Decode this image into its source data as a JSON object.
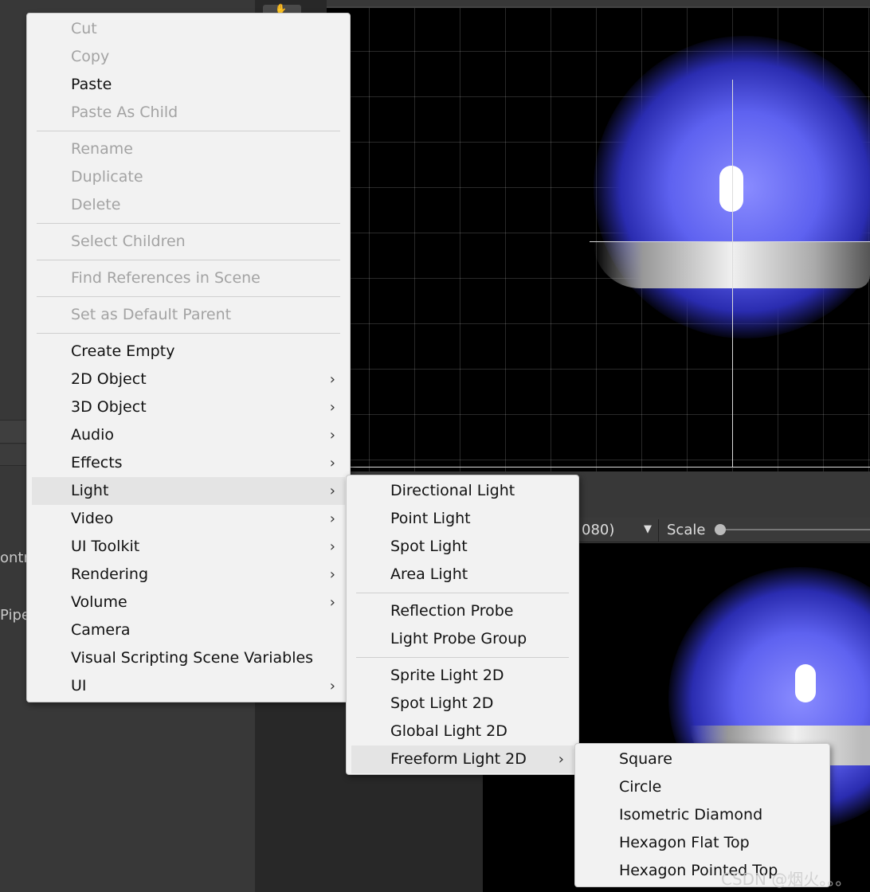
{
  "left_panel": {
    "text_1": "ontr",
    "text_2": "Pipe"
  },
  "game_view": {
    "resolution_partial": "080)",
    "scale_label": "Scale"
  },
  "main_menu": {
    "items": [
      {
        "label": "Cut",
        "enabled": false
      },
      {
        "label": "Copy",
        "enabled": false
      },
      {
        "label": "Paste",
        "enabled": true
      },
      {
        "label": "Paste As Child",
        "enabled": false
      },
      {
        "label": "Rename",
        "enabled": false
      },
      {
        "label": "Duplicate",
        "enabled": false
      },
      {
        "label": "Delete",
        "enabled": false
      },
      {
        "label": "Select Children",
        "enabled": false
      },
      {
        "label": "Find References in Scene",
        "enabled": false
      },
      {
        "label": "Set as Default Parent",
        "enabled": false
      },
      {
        "label": "Create Empty",
        "enabled": true
      },
      {
        "label": "2D Object",
        "enabled": true,
        "submenu": true
      },
      {
        "label": "3D Object",
        "enabled": true,
        "submenu": true
      },
      {
        "label": "Audio",
        "enabled": true,
        "submenu": true
      },
      {
        "label": "Effects",
        "enabled": true,
        "submenu": true
      },
      {
        "label": "Light",
        "enabled": true,
        "submenu": true,
        "highlighted": true
      },
      {
        "label": "Video",
        "enabled": true,
        "submenu": true
      },
      {
        "label": "UI Toolkit",
        "enabled": true,
        "submenu": true
      },
      {
        "label": "Rendering",
        "enabled": true,
        "submenu": true
      },
      {
        "label": "Volume",
        "enabled": true,
        "submenu": true
      },
      {
        "label": "Camera",
        "enabled": true
      },
      {
        "label": "Visual Scripting Scene Variables",
        "enabled": true
      },
      {
        "label": "UI",
        "enabled": true,
        "submenu": true
      }
    ]
  },
  "light_menu": {
    "items": [
      {
        "label": "Directional Light"
      },
      {
        "label": "Point Light"
      },
      {
        "label": "Spot Light"
      },
      {
        "label": "Area Light"
      },
      {
        "label": "Reflection Probe"
      },
      {
        "label": "Light Probe Group"
      },
      {
        "label": "Sprite Light 2D"
      },
      {
        "label": "Spot Light 2D"
      },
      {
        "label": "Global Light 2D"
      },
      {
        "label": "Freeform Light 2D",
        "submenu": true,
        "highlighted": true
      }
    ]
  },
  "freeform_menu": {
    "items": [
      {
        "label": "Square"
      },
      {
        "label": "Circle"
      },
      {
        "label": "Isometric Diamond"
      },
      {
        "label": "Hexagon Flat Top"
      },
      {
        "label": "Hexagon Pointed Top"
      }
    ]
  },
  "watermark": "CSDN @烟火。。。",
  "submenu_arrow": "›"
}
